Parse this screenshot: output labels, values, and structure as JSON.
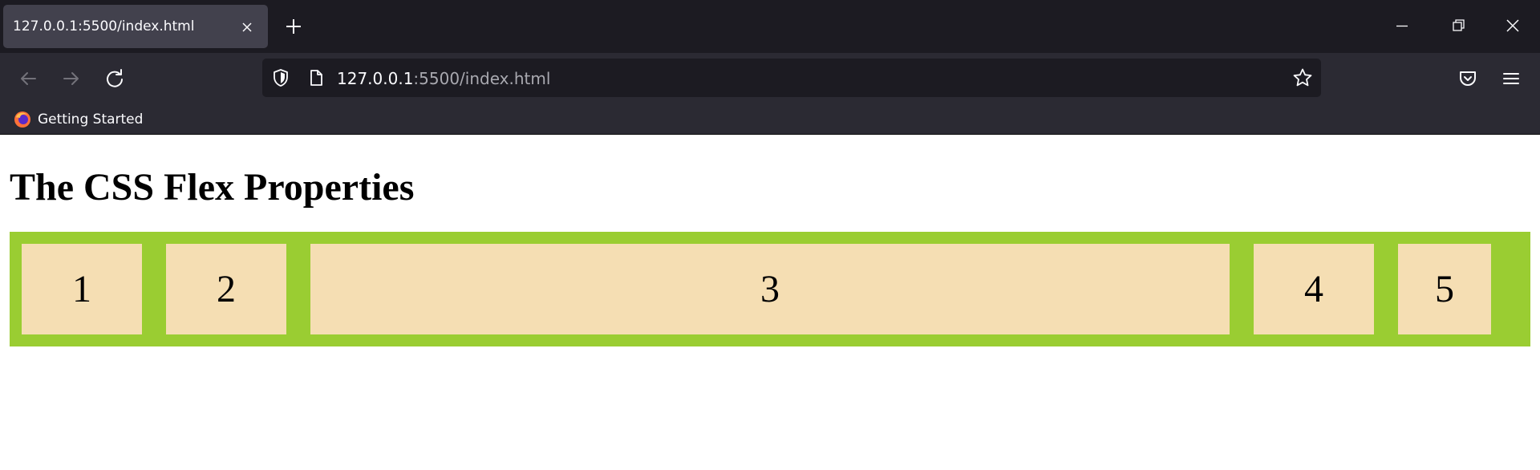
{
  "browser": {
    "tab": {
      "title": "127.0.0.1:5500/index.html"
    },
    "address": {
      "host": "127.0.0.1",
      "rest": ":5500/index.html"
    },
    "bookmarks": [
      {
        "label": "Getting Started"
      }
    ]
  },
  "page": {
    "heading": "The CSS Flex Properties",
    "items": [
      "1",
      "2",
      "3",
      "4",
      "5"
    ]
  },
  "colors": {
    "container_bg": "#9acd32",
    "item_bg": "#f5deb3",
    "tab_strip_bg": "#1c1b22",
    "toolbar_bg": "#2b2a33"
  },
  "icons": {
    "tab_close": "close-icon",
    "new_tab": "plus-icon",
    "minimize": "minimize-icon",
    "restore": "restore-icon",
    "close_window": "close-icon",
    "back": "back-arrow-icon",
    "forward": "forward-arrow-icon",
    "reload": "reload-icon",
    "tracking": "shield-icon",
    "page_info": "page-icon",
    "bookmark": "star-icon",
    "pocket": "pocket-icon",
    "menu": "hamburger-menu-icon",
    "bookmark_favicon": "firefox-icon"
  }
}
